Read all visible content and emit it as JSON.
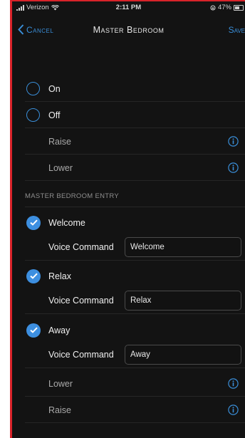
{
  "status_bar": {
    "carrier": "Verizon",
    "time": "2:11 PM",
    "battery": "47%",
    "battery_level": 0.47
  },
  "nav": {
    "cancel_label": "Cancel",
    "title": "Master Bedroom",
    "save_label": "Save"
  },
  "options": [
    {
      "label": "On",
      "control": "radio"
    },
    {
      "label": "Off",
      "control": "radio"
    },
    {
      "label": "Raise",
      "control": "info"
    },
    {
      "label": "Lower",
      "control": "info"
    }
  ],
  "section": {
    "title": "MASTER BEDROOM ENTRY",
    "scenes": [
      {
        "label": "Welcome",
        "checked": true,
        "voice_command_label": "Voice Command",
        "voice_command_value": "Welcome"
      },
      {
        "label": "Relax",
        "checked": true,
        "voice_command_label": "Voice Command",
        "voice_command_value": "Relax"
      },
      {
        "label": "Away",
        "checked": true,
        "voice_command_label": "Voice Command",
        "voice_command_value": "Away"
      }
    ],
    "extra_rows": [
      {
        "label": "Lower",
        "control": "info"
      },
      {
        "label": "Raise",
        "control": "info"
      }
    ]
  },
  "colors": {
    "accent": "#3a8ed8",
    "background": "#131313",
    "frame": "#d8232a"
  }
}
